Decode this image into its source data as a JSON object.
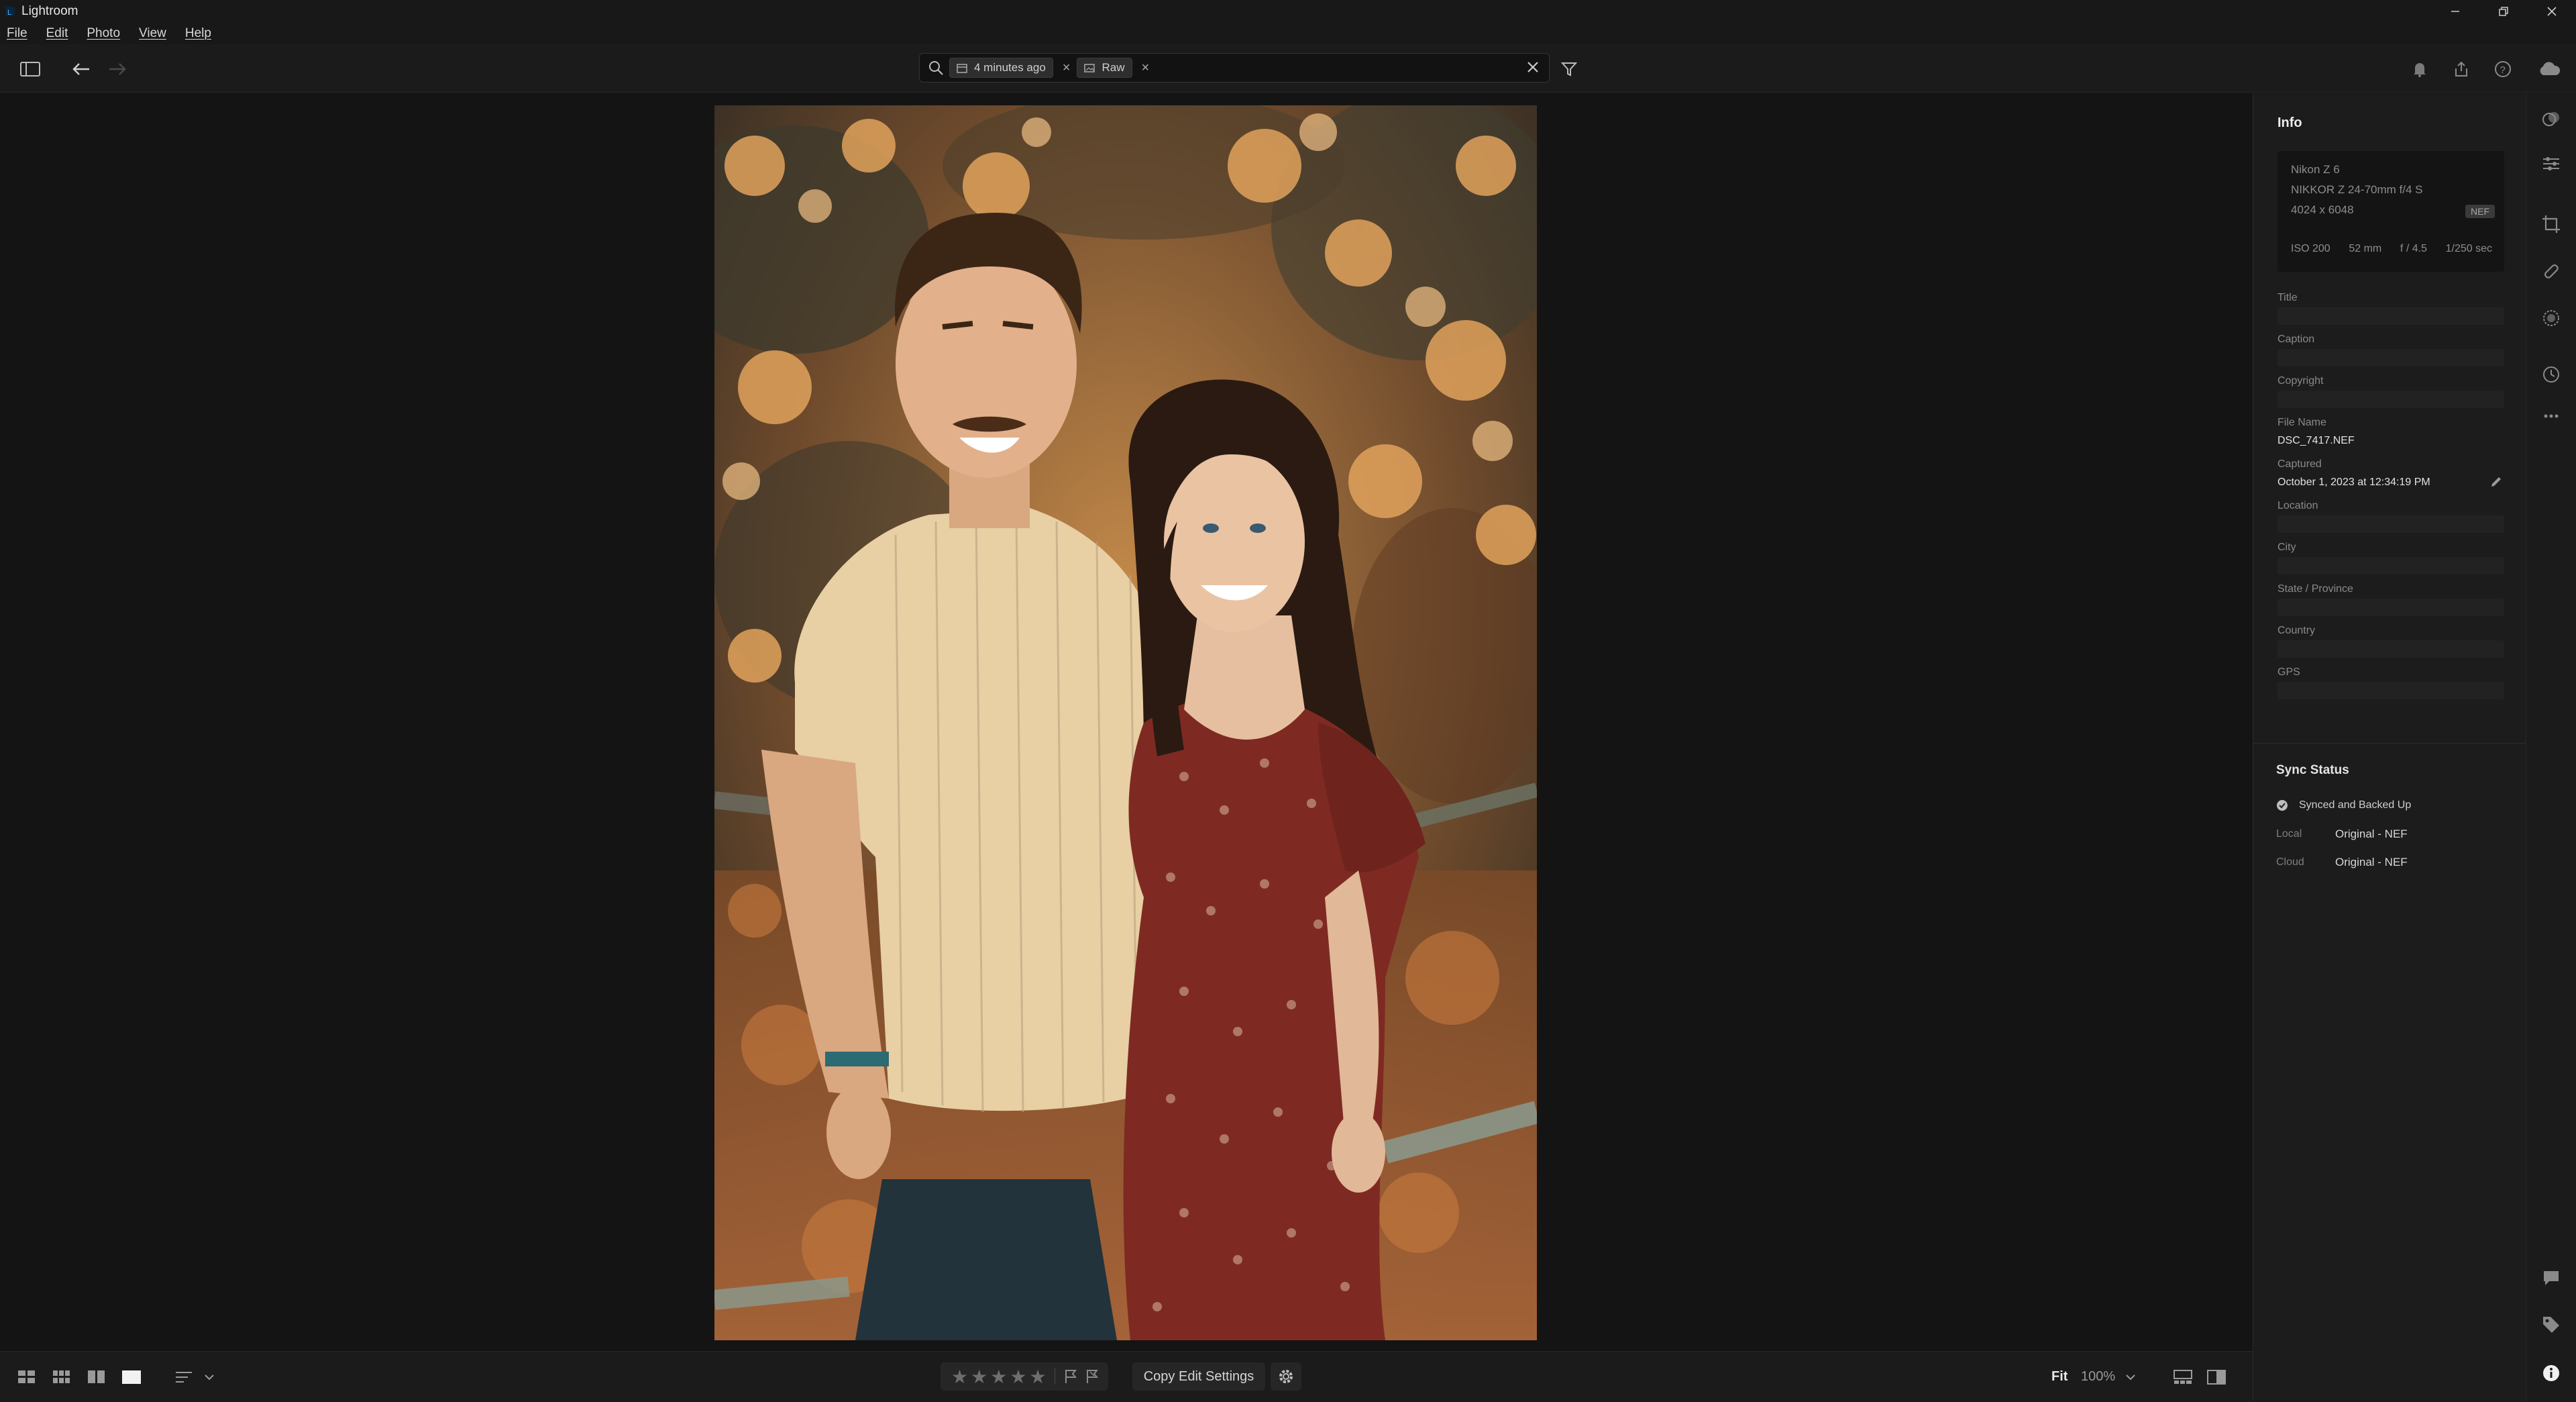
{
  "app": {
    "title": "Lightroom"
  },
  "menu": [
    "File",
    "Edit",
    "Photo",
    "View",
    "Help"
  ],
  "search": {
    "chips": [
      {
        "label": "4 minutes ago",
        "icon": "calendar-icon"
      },
      {
        "label": "Raw",
        "icon": "image-icon"
      }
    ]
  },
  "info_panel": {
    "heading": "Info",
    "camera": {
      "model": "Nikon Z 6",
      "lens": "NIKKOR Z 24-70mm f/4 S",
      "dimensions": "4024 x 6048",
      "format_badge": "NEF",
      "iso": "ISO 200",
      "focal_length": "52 mm",
      "aperture": "f / 4.5",
      "shutter": "1/250 sec"
    },
    "fields": {
      "title_label": "Title",
      "caption_label": "Caption",
      "copyright_label": "Copyright",
      "filename_label": "File Name",
      "filename_value": "DSC_7417.NEF",
      "captured_label": "Captured",
      "captured_value": "October 1, 2023 at 12:34:19 PM",
      "location_label": "Location",
      "city_label": "City",
      "state_label": "State / Province",
      "country_label": "Country",
      "gps_label": "GPS"
    }
  },
  "sync": {
    "heading": "Sync Status",
    "status": "Synced and Backed Up",
    "local_label": "Local",
    "local_value": "Original - NEF",
    "cloud_label": "Cloud",
    "cloud_value": "Original - NEF"
  },
  "bottom": {
    "copy_label": "Copy Edit Settings",
    "fit_label": "Fit",
    "zoom_label": "100%",
    "rating": 0
  },
  "colors": {
    "background": "#141414",
    "panel": "#1c1c1c",
    "accent": "#1473e6"
  }
}
